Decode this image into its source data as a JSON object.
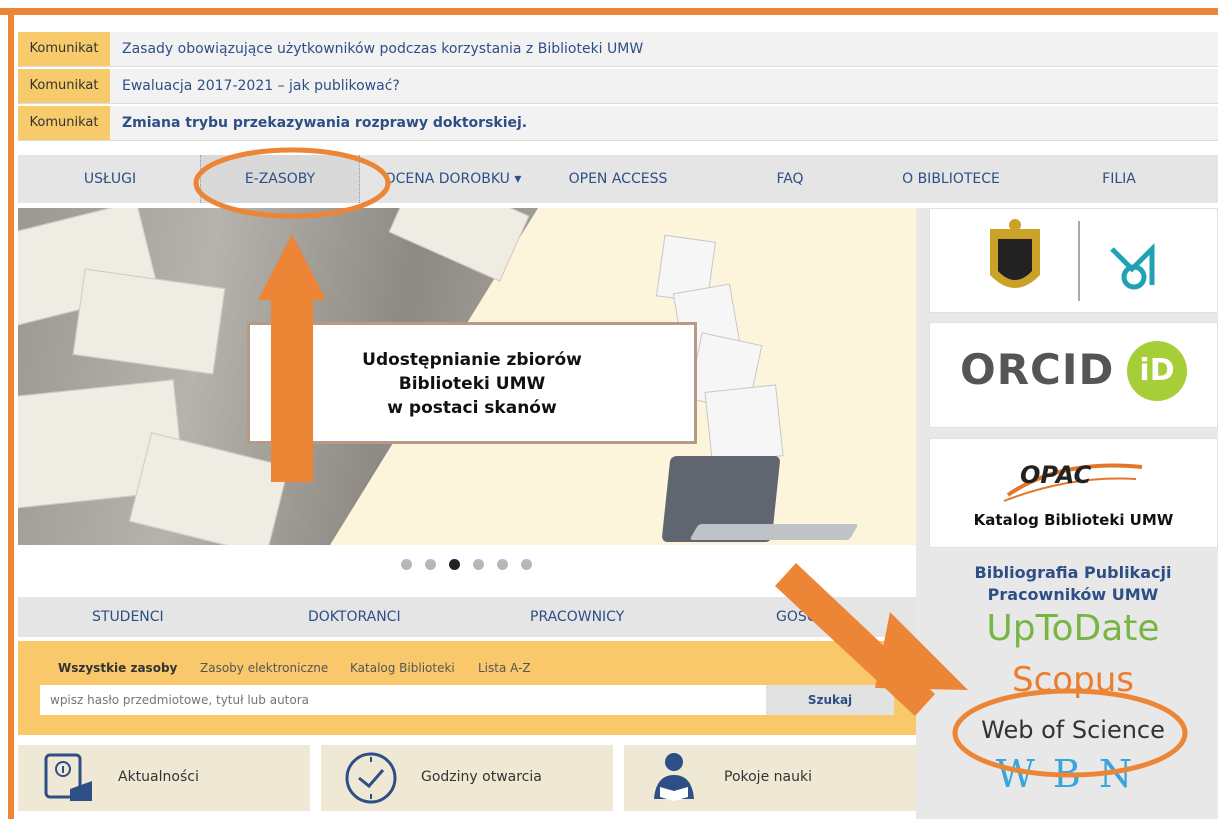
{
  "notices": [
    {
      "tag": "Komunikat",
      "text": "Zasady obowiązujące użytkowników podczas korzystania z Biblioteki UMW"
    },
    {
      "tag": "Komunikat",
      "text": "Ewaluacja 2017-2021 – jak publikować?"
    },
    {
      "tag": "Komunikat",
      "text": "Zmiana trybu przekazywania rozprawy doktorskiej."
    }
  ],
  "nav": {
    "uslugi": "USŁUGI",
    "ezasoby": "E-ZASOBY",
    "ocena": "OCENA DOROBKU ▾",
    "open_access": "OPEN ACCESS",
    "faq": "FAQ",
    "o_bibliotece": "O BIBLIOTECE",
    "filia": "FILIA"
  },
  "hero": {
    "line1": "Udostępnianie zbiorów",
    "line2": "Biblioteki UMW",
    "line3": "w postaci skanów",
    "slide_count": 6,
    "active_slide": 3
  },
  "subnav": {
    "studenci": "STUDENCI",
    "doktoranci": "DOKTORANCI",
    "pracownicy": "PRACOWNICY",
    "goscie": "GOŚCIE"
  },
  "search": {
    "tabs": [
      "Wszystkie zasoby",
      "Zasoby elektroniczne",
      "Katalog Biblioteki",
      "Lista A-Z"
    ],
    "placeholder": "wpisz hasło przedmiotowe, tytuł lub autora",
    "button": "Szukaj"
  },
  "tiles": {
    "aktualnosci": "Aktualności",
    "godziny": "Godziny otwarcia",
    "pokoje": "Pokoje nauki"
  },
  "sidebar": {
    "orcid": "ORCID",
    "orcid_id": "iD",
    "opac": "OPAC",
    "opac_caption": "Katalog Biblioteki UMW",
    "bibliografia": "Bibliografia Publikacji Pracowników UMW",
    "uptodate": "UpToDate",
    "scopus": "Scopus",
    "wos": "Web of Science",
    "wbn": "WBN"
  },
  "colors": {
    "accent_orange": "#ec8535",
    "notice_tag": "#f7cb6b",
    "link_blue": "#2d4f86",
    "search_panel": "#f8c86a"
  }
}
